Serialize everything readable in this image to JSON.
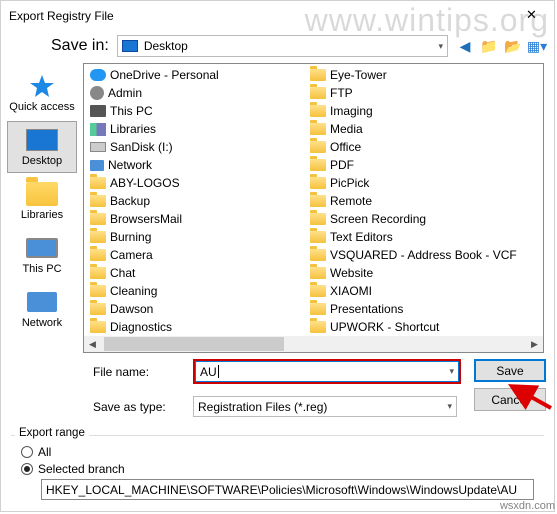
{
  "watermark": {
    "top": "www.wintips.org",
    "bottom": "wsxdn.com"
  },
  "title": "Export Registry File",
  "save_in": {
    "label": "Save in:",
    "value": "Desktop"
  },
  "places": {
    "quick_access": "Quick access",
    "desktop": "Desktop",
    "libraries": "Libraries",
    "this_pc": "This PC",
    "network": "Network"
  },
  "file_list": {
    "col1": [
      {
        "icon": "cloud",
        "name": "OneDrive - Personal"
      },
      {
        "icon": "user",
        "name": "Admin"
      },
      {
        "icon": "pc",
        "name": "This PC"
      },
      {
        "icon": "lib",
        "name": "Libraries"
      },
      {
        "icon": "drive",
        "name": "SanDisk (I:)"
      },
      {
        "icon": "net",
        "name": "Network"
      },
      {
        "icon": "folder",
        "name": "ABY-LOGOS"
      },
      {
        "icon": "folder",
        "name": "Backup"
      },
      {
        "icon": "folder",
        "name": "BrowsersMail"
      },
      {
        "icon": "folder",
        "name": "Burning"
      },
      {
        "icon": "folder",
        "name": "Camera"
      },
      {
        "icon": "folder",
        "name": "Chat"
      },
      {
        "icon": "folder",
        "name": "Cleaning"
      },
      {
        "icon": "folder",
        "name": "Dawson"
      },
      {
        "icon": "folder",
        "name": "Diagnostics"
      }
    ],
    "col2": [
      {
        "icon": "folder",
        "name": "Eye-Tower"
      },
      {
        "icon": "folder",
        "name": "FTP"
      },
      {
        "icon": "folder",
        "name": "Imaging"
      },
      {
        "icon": "folder",
        "name": "Media"
      },
      {
        "icon": "folder",
        "name": "Office"
      },
      {
        "icon": "folder",
        "name": "PDF"
      },
      {
        "icon": "folder",
        "name": "PicPick"
      },
      {
        "icon": "folder",
        "name": "Remote"
      },
      {
        "icon": "folder",
        "name": "Screen Recording"
      },
      {
        "icon": "folder",
        "name": "Text Editors"
      },
      {
        "icon": "folder",
        "name": "VSQUARED - Address Book - VCF"
      },
      {
        "icon": "folder",
        "name": "Website"
      },
      {
        "icon": "folder",
        "name": "XIAOMI"
      },
      {
        "icon": "folder",
        "name": "Presentations"
      },
      {
        "icon": "folder",
        "name": "UPWORK - Shortcut"
      }
    ]
  },
  "filename": {
    "label": "File name:",
    "value": "AU"
  },
  "save_type": {
    "label": "Save as type:",
    "value": "Registration Files (*.reg)"
  },
  "buttons": {
    "save": "Save",
    "cancel": "Cancel"
  },
  "export_range": {
    "legend": "Export range",
    "all": "All",
    "selected_branch": "Selected branch",
    "branch_path": "HKEY_LOCAL_MACHINE\\SOFTWARE\\Policies\\Microsoft\\Windows\\WindowsUpdate\\AU"
  }
}
